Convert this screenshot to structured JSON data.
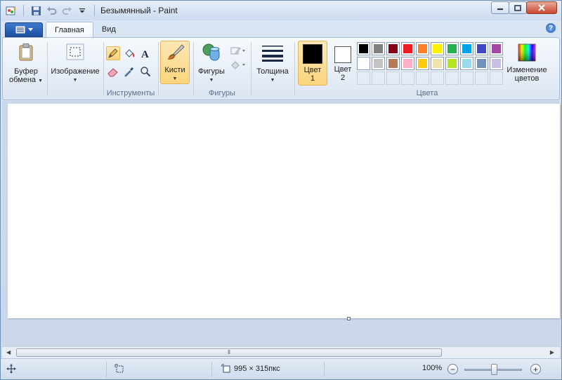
{
  "window": {
    "title": "Безымянный - Paint",
    "controls": {
      "minimize": "minimize",
      "maximize": "maximize",
      "close": "close"
    }
  },
  "ribbon": {
    "tabs": [
      {
        "label": "Главная",
        "active": true
      },
      {
        "label": "Вид",
        "active": false
      }
    ],
    "groups": {
      "clipboard": {
        "label_line1": "Буфер",
        "label_line2": "обмена"
      },
      "image": {
        "label": "Изображение"
      },
      "tools": {
        "group_label": "Инструменты"
      },
      "brushes": {
        "label": "Кисти"
      },
      "shapes": {
        "label": "Фигуры",
        "group_label": "Фигуры"
      },
      "size": {
        "label": "Толщина"
      },
      "colors": {
        "color1_line1": "Цвет",
        "color1_line2": "1",
        "color2_line1": "Цвет",
        "color2_line2": "2",
        "edit_line1": "Изменение",
        "edit_line2": "цветов",
        "group_label": "Цвета",
        "color1_value": "#000000",
        "color2_value": "#ffffff",
        "palette_row1": [
          "#000000",
          "#7f7f7f",
          "#880015",
          "#ed1c24",
          "#ff7f27",
          "#fff200",
          "#22b14c",
          "#00a2e8",
          "#3f48cc",
          "#a349a4"
        ],
        "palette_row2": [
          "#ffffff",
          "#c3c3c3",
          "#b97a57",
          "#ffaec9",
          "#ffc90e",
          "#efe4b0",
          "#b5e61d",
          "#99d9ea",
          "#7092be",
          "#c8bfe7"
        ]
      }
    }
  },
  "statusbar": {
    "image_size": "995 × 315пкс",
    "zoom": "100%"
  }
}
